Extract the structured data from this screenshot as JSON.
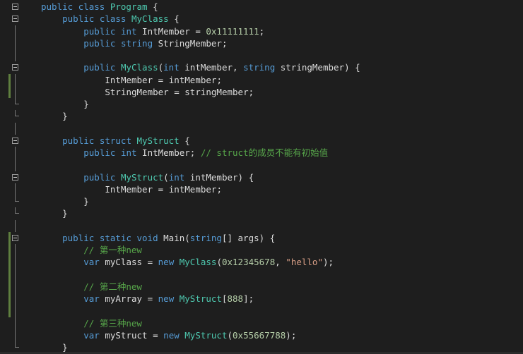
{
  "editor": {
    "language": "C#",
    "colors": {
      "background": "#1e1e1e",
      "keyword": "#569cd6",
      "type": "#4ec9b0",
      "plain": "#dcdcdc",
      "comment": "#57a64a",
      "number": "#b5cea8",
      "string": "#d69d85",
      "change_marker": "#5f7f3f"
    },
    "lines": [
      {
        "fold": "open",
        "change": false,
        "text": "public class Program {"
      },
      {
        "fold": "open",
        "change": false,
        "text": "    public class MyClass {"
      },
      {
        "fold": "line",
        "change": false,
        "text": "        public int IntMember = 0x11111111;"
      },
      {
        "fold": "line",
        "change": false,
        "text": "        public string StringMember;"
      },
      {
        "fold": "line",
        "change": false,
        "text": ""
      },
      {
        "fold": "open",
        "change": false,
        "text": "        public MyClass(int intMember, string stringMember) {"
      },
      {
        "fold": "line",
        "change": true,
        "text": "            IntMember = intMember;"
      },
      {
        "fold": "line",
        "change": true,
        "text": "            StringMember = stringMember;"
      },
      {
        "fold": "end",
        "change": false,
        "text": "        }"
      },
      {
        "fold": "end",
        "change": false,
        "text": "    }"
      },
      {
        "fold": "line",
        "change": false,
        "text": ""
      },
      {
        "fold": "open",
        "change": false,
        "text": "    public struct MyStruct {"
      },
      {
        "fold": "line",
        "change": false,
        "text": "        public int IntMember; // struct的成员不能有初始值"
      },
      {
        "fold": "line",
        "change": false,
        "text": ""
      },
      {
        "fold": "open",
        "change": false,
        "text": "        public MyStruct(int intMember) {"
      },
      {
        "fold": "line",
        "change": false,
        "text": "            IntMember = intMember;"
      },
      {
        "fold": "end",
        "change": false,
        "text": "        }"
      },
      {
        "fold": "end",
        "change": false,
        "text": "    }"
      },
      {
        "fold": "line",
        "change": false,
        "text": ""
      },
      {
        "fold": "open",
        "change": true,
        "text": "    public static void Main(string[] args) {"
      },
      {
        "fold": "line",
        "change": true,
        "text": "        // 第一种new"
      },
      {
        "fold": "line",
        "change": true,
        "text": "        var myClass = new MyClass(0x12345678, \"hello\");"
      },
      {
        "fold": "line",
        "change": true,
        "text": ""
      },
      {
        "fold": "line",
        "change": true,
        "text": "        // 第二种new"
      },
      {
        "fold": "line",
        "change": true,
        "text": "        var myArray = new MyStruct[888];"
      },
      {
        "fold": "line",
        "change": true,
        "text": ""
      },
      {
        "fold": "line",
        "change": false,
        "text": "        // 第三种new"
      },
      {
        "fold": "line",
        "change": false,
        "text": "        var myStruct = new MyStruct(0x55667788);"
      },
      {
        "fold": "end",
        "change": false,
        "text": "    }"
      }
    ]
  }
}
